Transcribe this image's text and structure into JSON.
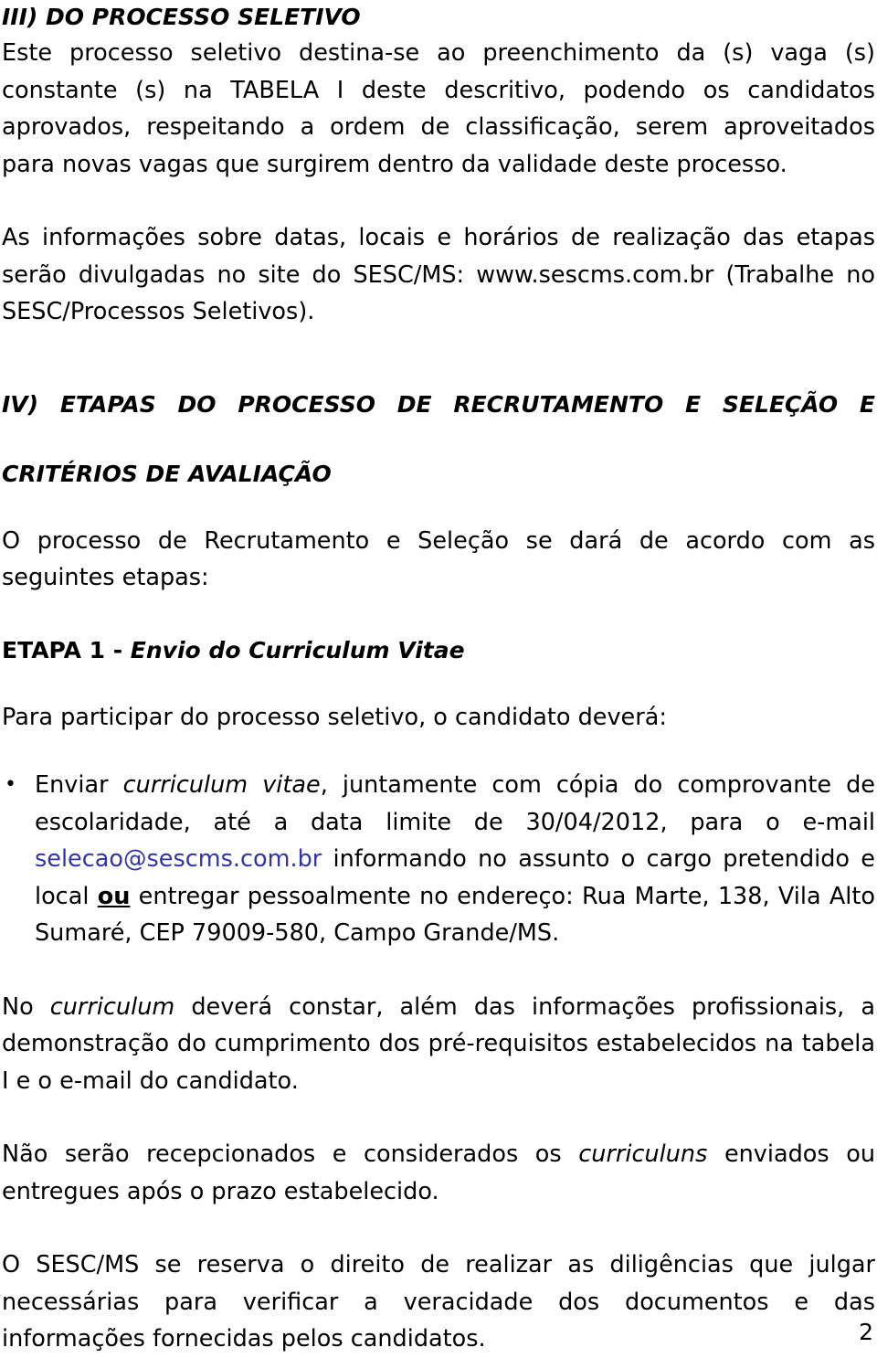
{
  "document": {
    "page_number": "2",
    "link_color": "#3333aa",
    "text_color": "#000000",
    "background_color": "#ffffff"
  },
  "sections": {
    "heading_iii": "III) DO PROCESSO SELETIVO",
    "para_1": "Este processo seletivo destina-se ao preenchimento da (s) vaga (s) constante (s) na TABELA I deste descritivo, podendo os candidatos aprovados, respeitando a ordem de classificação, serem aproveitados para novas vagas que surgirem dentro da validade deste processo.",
    "para_2_part1": "As informações sobre datas, locais e horários de realização das etapas serão divulgadas no site do SESC/MS: www.sescms.com.br (Trabalhe no SESC/Processos Seletivos).",
    "heading_iv_line1": "IV) ETAPAS DO PROCESSO DE RECRUTAMENTO E SELEÇÃO E",
    "heading_iv_line2": "CRITÉRIOS DE AVALIAÇÃO",
    "para_3": "O processo de Recrutamento e Seleção se dará de acordo com as seguintes etapas:",
    "heading_etapa1_prefix": "ETAPA 1 - ",
    "heading_etapa1_italic": "Envio do Curriculum Vitae",
    "para_4": "Para participar do processo seletivo, o candidato deverá:",
    "bullet_1": {
      "marker": "bullet-dot",
      "seg_1": "Enviar ",
      "seg_2_italic": "curriculum vitae",
      "seg_3": ", juntamente com cópia do comprovante de escolaridade, até a data limite de 30/04/2012, para o e-mail ",
      "seg_4_email": "selecao@sescms.com.br",
      "seg_5": " informando no assunto o cargo pretendido e local ",
      "seg_6_bold_underline": "ou",
      "seg_7": " entregar pessoalmente no endereço: Rua Marte, 138, Vila Alto Sumaré, CEP 79009-580, Campo Grande/MS."
    },
    "para_5": {
      "seg_1": "No ",
      "seg_2_italic": "curriculum",
      "seg_3": " deverá constar, além das informações profissionais, a demonstração do cumprimento dos pré-requisitos estabelecidos na tabela I e o e-mail do candidato."
    },
    "para_6": {
      "seg_1": "Não serão recepcionados e considerados os ",
      "seg_2_italic": "curriculuns",
      "seg_3": " enviados ou entregues após o prazo estabelecido."
    },
    "para_7": "O SESC/MS se reserva o direito de realizar as diligências que julgar necessárias para verificar a veracidade dos documentos e das informações fornecidas pelos candidatos."
  }
}
